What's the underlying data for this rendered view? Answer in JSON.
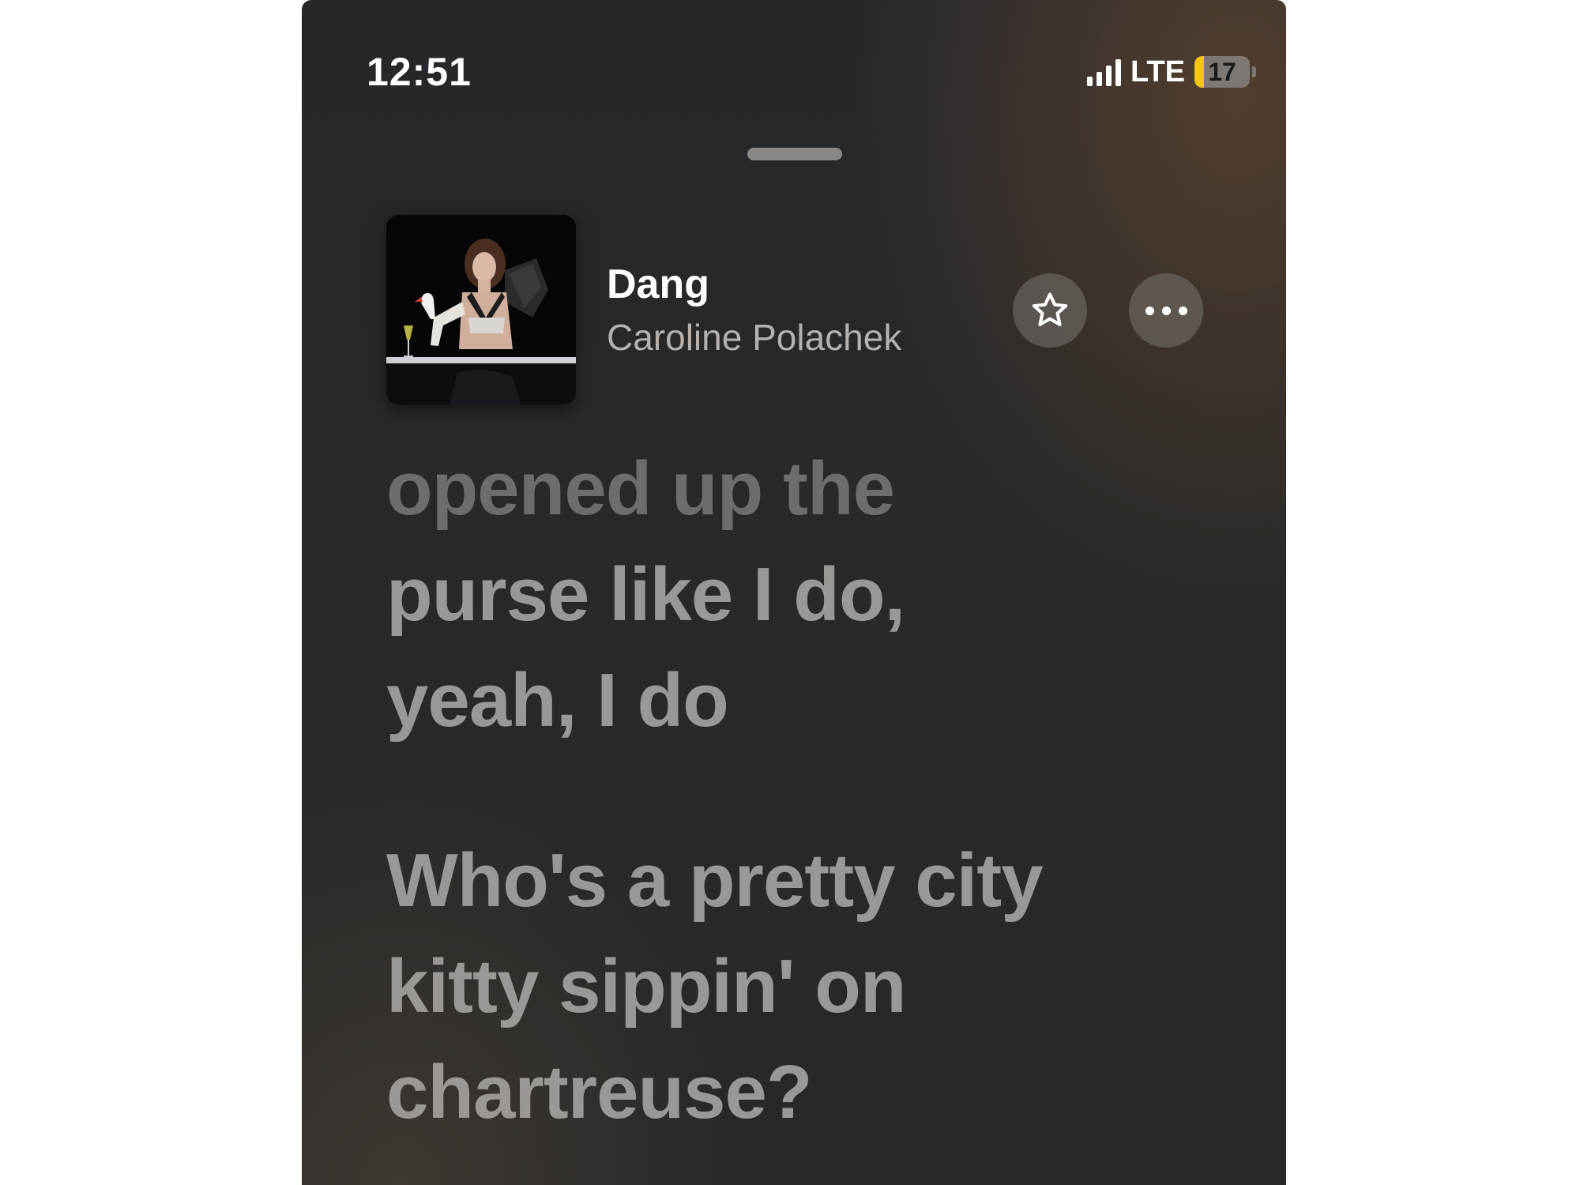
{
  "status_bar": {
    "time": "12:51",
    "network": "LTE",
    "battery_level": "17",
    "battery_fraction": 0.17
  },
  "now_playing": {
    "title": "Dang",
    "artist": "Caroline Polachek",
    "favorite_icon": "star-outline-icon",
    "more_icon": "ellipsis-icon"
  },
  "lyrics": {
    "lines": [
      "opened up the",
      "purse like I do,",
      "yeah, I do",
      "Who's a pretty city",
      "kitty sippin' on",
      "chartreuse?"
    ]
  },
  "colors": {
    "battery_fill": "#f4c511",
    "lyric_text": "#9b9794"
  }
}
